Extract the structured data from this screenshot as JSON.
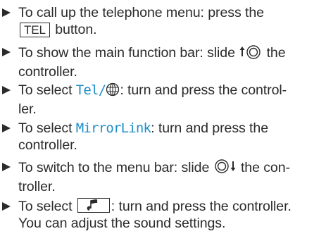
{
  "steps": [
    {
      "line1_before": "To call up the telephone menu: press the",
      "key": "TEL",
      "line2_after": " button."
    },
    {
      "line1_before": "To show the main function bar: slide ",
      "line1_after": " the",
      "line2": "controller.",
      "icon": "controller-slide-up-icon"
    },
    {
      "line1_before": "To select ",
      "display": "Tel/",
      "line1_after": ": turn and press the control-",
      "line2": "ler.",
      "icon": "globe-icon"
    },
    {
      "line1_before": "To select ",
      "display": "MirrorLink",
      "line1_after": ": turn and press the",
      "line2": "controller."
    },
    {
      "line1_before": "To switch to the menu bar: slide ",
      "line1_after": " the con-",
      "line2": "troller.",
      "icon": "controller-slide-down-icon"
    },
    {
      "line1_before": "To select ",
      "line1_after": ": turn and press the controller.",
      "line2": "You can adjust the sound settings.",
      "icon": "sound-settings-icon"
    }
  ],
  "colors": {
    "text": "#2b2b2b",
    "display_text": "#1f8fc9"
  }
}
